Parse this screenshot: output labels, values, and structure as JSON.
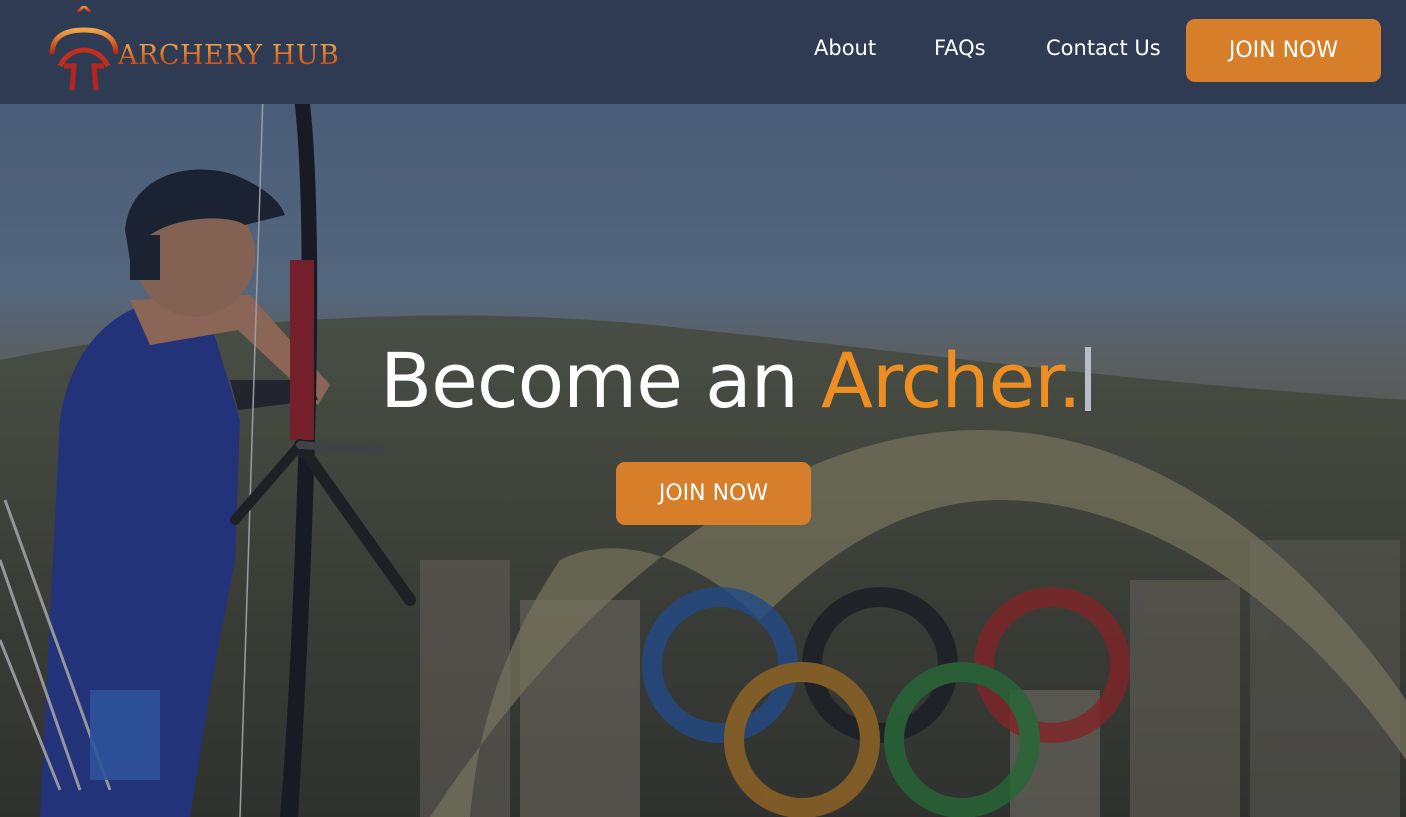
{
  "brand": {
    "name": "ARCHERY HUB",
    "logo_icon": "bow-arrow-logo-icon"
  },
  "nav": {
    "items": [
      {
        "label": "About"
      },
      {
        "label": "FAQs"
      },
      {
        "label": "Contact Us"
      }
    ],
    "cta_label": "JOIN NOW"
  },
  "hero": {
    "headline_lead": "Become an ",
    "headline_accent": "Archer.",
    "cta_label": "JOIN NOW",
    "background_image": "archer-drawing-bow-with-olympic-rings"
  },
  "colors": {
    "navbar": "#2e3b52",
    "accent": "#d67e2a",
    "headline_accent": "#ee8e22",
    "text": "#ffffff"
  }
}
